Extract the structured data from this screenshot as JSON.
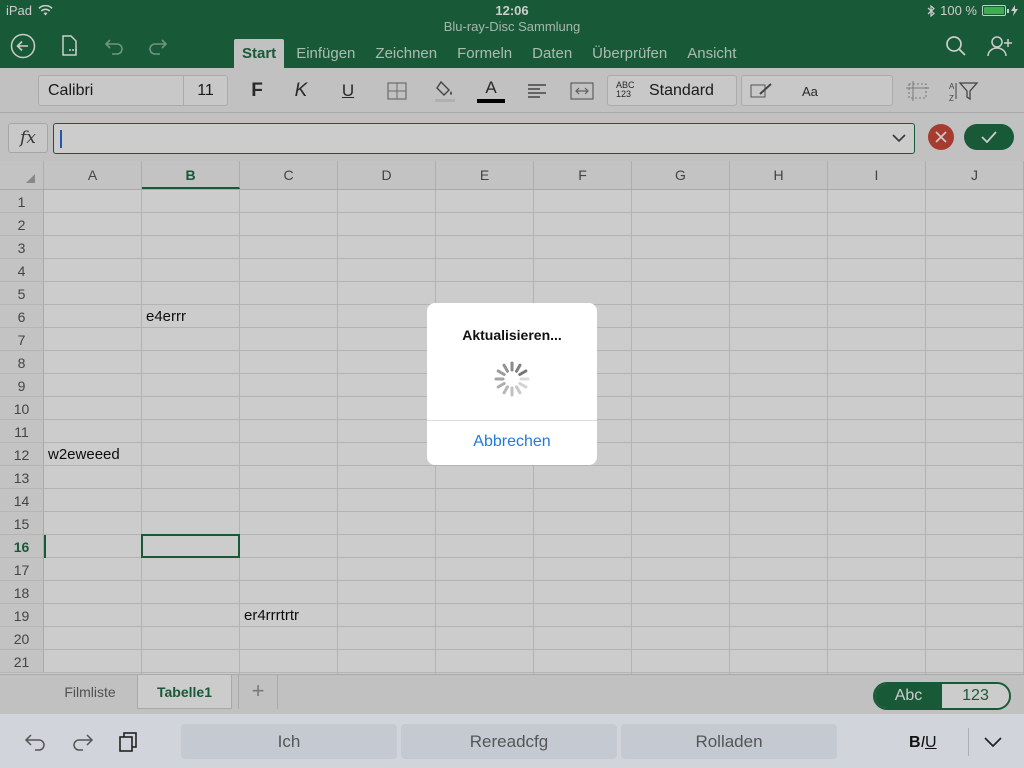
{
  "status": {
    "device": "iPad",
    "time": "12:06",
    "battery": "100 %",
    "battery_level": 1.0
  },
  "document": {
    "title": "Blu-ray-Disc Sammlung"
  },
  "ribbon_tabs": [
    "Start",
    "Einfügen",
    "Zeichnen",
    "Formeln",
    "Daten",
    "Überprüfen",
    "Ansicht"
  ],
  "active_tab": "Start",
  "ribbon": {
    "font_name": "Calibri",
    "font_size": "11",
    "bold": "F",
    "italic": "K",
    "underline": "U",
    "font_color_letter": "A",
    "number_format_icon_top": "ABC",
    "number_format_icon_bottom": "123",
    "number_format": "Standard",
    "cell_styles": "Aa"
  },
  "formula_bar": {
    "fx_label": "fx",
    "value": ""
  },
  "grid": {
    "columns": [
      "A",
      "B",
      "C",
      "D",
      "E",
      "F",
      "G",
      "H",
      "I",
      "J"
    ],
    "rows": [
      "1",
      "2",
      "3",
      "4",
      "5",
      "6",
      "7",
      "8",
      "9",
      "10",
      "11",
      "12",
      "13",
      "14",
      "15",
      "16",
      "17",
      "18",
      "19",
      "20",
      "21"
    ],
    "selected_column": "B",
    "selected_row": "16",
    "cells": [
      {
        "ref": "B6",
        "value": "e4errr"
      },
      {
        "ref": "A12",
        "value": "w2eweeed"
      },
      {
        "ref": "C19",
        "value": "er4rrrtrtr"
      }
    ]
  },
  "sheets": [
    "Filmliste",
    "Tabelle1"
  ],
  "active_sheet": "Tabelle1",
  "add_sheet": "+",
  "keyboard_mode": {
    "text": "Abc",
    "numeric": "123",
    "active": "Abc"
  },
  "keyboard_bar": {
    "suggestions": [
      "Ich",
      "Rereadcfg",
      "Rolladen"
    ],
    "biu": {
      "b": "B",
      "i": "I",
      "u": "U"
    }
  },
  "dialog": {
    "title": "Aktualisieren...",
    "button": "Abbrechen"
  },
  "colors": {
    "brand": "#1e7145",
    "link": "#1f7ae0",
    "cancel": "#d04a3b"
  }
}
